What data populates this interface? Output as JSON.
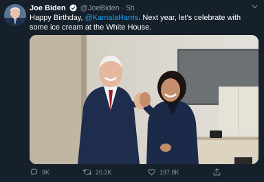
{
  "tweet": {
    "author_name": "Joe Biden",
    "handle": "@JoeBiden",
    "separator": "·",
    "time": "5h",
    "text_before": "Happy Birthday, ",
    "mention": "@KamalaHarris",
    "text_after": ". Next year, let's celebrate with some ice cream at the White House."
  },
  "actions": {
    "replies": "9K",
    "retweets": "20.2K",
    "likes": "197.8K"
  },
  "colors": {
    "background": "#15202b",
    "accent": "#1da1f2",
    "secondary_text": "#8899a6"
  },
  "icons": [
    "verified-icon",
    "chevron-down-icon",
    "reply-icon",
    "retweet-icon",
    "like-icon",
    "share-icon"
  ]
}
